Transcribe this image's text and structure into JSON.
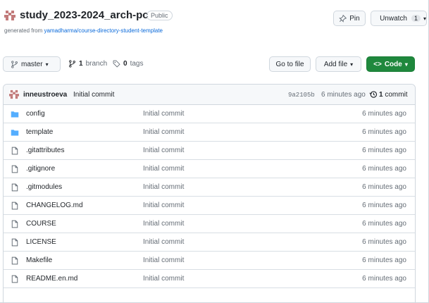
{
  "repo": {
    "name": "study_2023-2024_arch-pc",
    "visibility": "Public",
    "generated_prefix": "generated from ",
    "template_link": "yamadharma/course-directory-student-template"
  },
  "actions": {
    "pin_label": "Pin",
    "unwatch_label": "Unwatch",
    "watch_count": "1"
  },
  "toolbar": {
    "branch_name": "master",
    "branch_count": "1",
    "branch_word": "branch",
    "tag_count": "0",
    "tag_word": "tags",
    "go_to_file": "Go to file",
    "add_file": "Add file",
    "code": "Code"
  },
  "latest_commit": {
    "author": "inneustroeva",
    "message": "Initial commit",
    "sha": "9a2105b",
    "time": "6 minutes ago",
    "count": "1",
    "count_word": "commit"
  },
  "files": [
    {
      "name": "config",
      "type": "folder",
      "commit": "Initial commit",
      "time": "6 minutes ago"
    },
    {
      "name": "template",
      "type": "folder",
      "commit": "Initial commit",
      "time": "6 minutes ago"
    },
    {
      "name": ".gitattributes",
      "type": "file",
      "commit": "Initial commit",
      "time": "6 minutes ago"
    },
    {
      "name": ".gitignore",
      "type": "file",
      "commit": "Initial commit",
      "time": "6 minutes ago"
    },
    {
      "name": ".gitmodules",
      "type": "file",
      "commit": "Initial commit",
      "time": "6 minutes ago"
    },
    {
      "name": "CHANGELOG.md",
      "type": "file",
      "commit": "Initial commit",
      "time": "6 minutes ago"
    },
    {
      "name": "COURSE",
      "type": "file",
      "commit": "Initial commit",
      "time": "6 minutes ago"
    },
    {
      "name": "LICENSE",
      "type": "file",
      "commit": "Initial commit",
      "time": "6 minutes ago"
    },
    {
      "name": "Makefile",
      "type": "file",
      "commit": "Initial commit",
      "time": "6 minutes ago"
    },
    {
      "name": "README.en.md",
      "type": "file",
      "commit": "Initial commit",
      "time": "6 minutes ago"
    }
  ],
  "colors": {
    "link": "#0969da",
    "folder": "#54aeff",
    "code_button": "#1f883d",
    "avatar": "#c27b7b"
  }
}
